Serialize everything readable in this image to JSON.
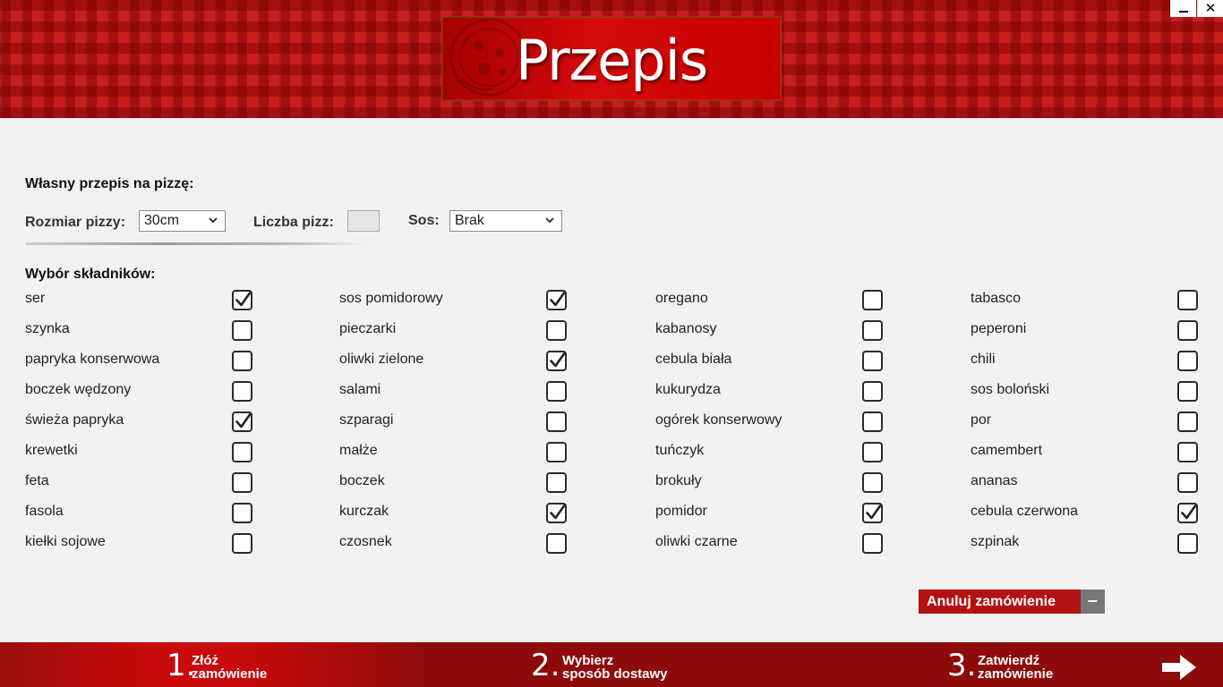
{
  "window": {
    "minimize_label": "",
    "close_label": "✕"
  },
  "header": {
    "title": "Przepis"
  },
  "form": {
    "section_title": "Własny przepis na pizzę:",
    "size_label": "Rozmiar pizzy:",
    "size_value": "30cm",
    "count_label": "Liczba pizz:",
    "count_value": "",
    "sauce_label": "Sos:",
    "sauce_value": "Brak"
  },
  "ingredients": {
    "title": "Wybór składników:",
    "columns": [
      [
        {
          "name": "ser",
          "checked": true
        },
        {
          "name": "szynka",
          "checked": false
        },
        {
          "name": "papryka konserwowa",
          "checked": false
        },
        {
          "name": "boczek wędzony",
          "checked": false
        },
        {
          "name": "świeża papryka",
          "checked": true
        },
        {
          "name": "krewetki",
          "checked": false
        },
        {
          "name": "feta",
          "checked": false
        },
        {
          "name": "fasola",
          "checked": false
        },
        {
          "name": "kiełki sojowe",
          "checked": false
        }
      ],
      [
        {
          "name": "sos pomidorowy",
          "checked": true
        },
        {
          "name": "pieczarki",
          "checked": false
        },
        {
          "name": "oliwki zielone",
          "checked": true
        },
        {
          "name": "salami",
          "checked": false
        },
        {
          "name": "szparagi",
          "checked": false
        },
        {
          "name": "małże",
          "checked": false
        },
        {
          "name": "boczek",
          "checked": false
        },
        {
          "name": "kurczak",
          "checked": true
        },
        {
          "name": "czosnek",
          "checked": false
        }
      ],
      [
        {
          "name": "oregano",
          "checked": false
        },
        {
          "name": "kabanosy",
          "checked": false
        },
        {
          "name": "cebula biała",
          "checked": false
        },
        {
          "name": "kukurydza",
          "checked": false
        },
        {
          "name": "ogórek konserwowy",
          "checked": false
        },
        {
          "name": "tuńczyk",
          "checked": false
        },
        {
          "name": "brokuły",
          "checked": false
        },
        {
          "name": "pomidor",
          "checked": true
        },
        {
          "name": "oliwki czarne",
          "checked": false
        }
      ],
      [
        {
          "name": "tabasco",
          "checked": false
        },
        {
          "name": "peperoni",
          "checked": false
        },
        {
          "name": "chili",
          "checked": false
        },
        {
          "name": "sos boloński",
          "checked": false
        },
        {
          "name": "por",
          "checked": false
        },
        {
          "name": "camembert",
          "checked": false
        },
        {
          "name": "ananas",
          "checked": false
        },
        {
          "name": "cebula czerwona",
          "checked": true
        },
        {
          "name": "szpinak",
          "checked": false
        }
      ]
    ]
  },
  "actions": {
    "cancel_label": "Anuluj zamówienie",
    "cancel_icon": "−"
  },
  "steps": [
    {
      "number": "1.",
      "line1": "Złóż",
      "line2": "zamówienie",
      "active": true
    },
    {
      "number": "2.",
      "line1": "Wybierz",
      "line2": "sposób dostawy",
      "active": false
    },
    {
      "number": "3.",
      "line1": "Zatwierdź",
      "line2": "zamówienie",
      "active": false
    }
  ],
  "icons": {
    "next": "arrow-right-icon",
    "check": "checkmark-icon",
    "dropdown": "chevron-down-icon"
  },
  "colors": {
    "brand_red": "#c81e1e",
    "footer_red": "#8e0b0b",
    "cancel_red": "#b31212"
  }
}
